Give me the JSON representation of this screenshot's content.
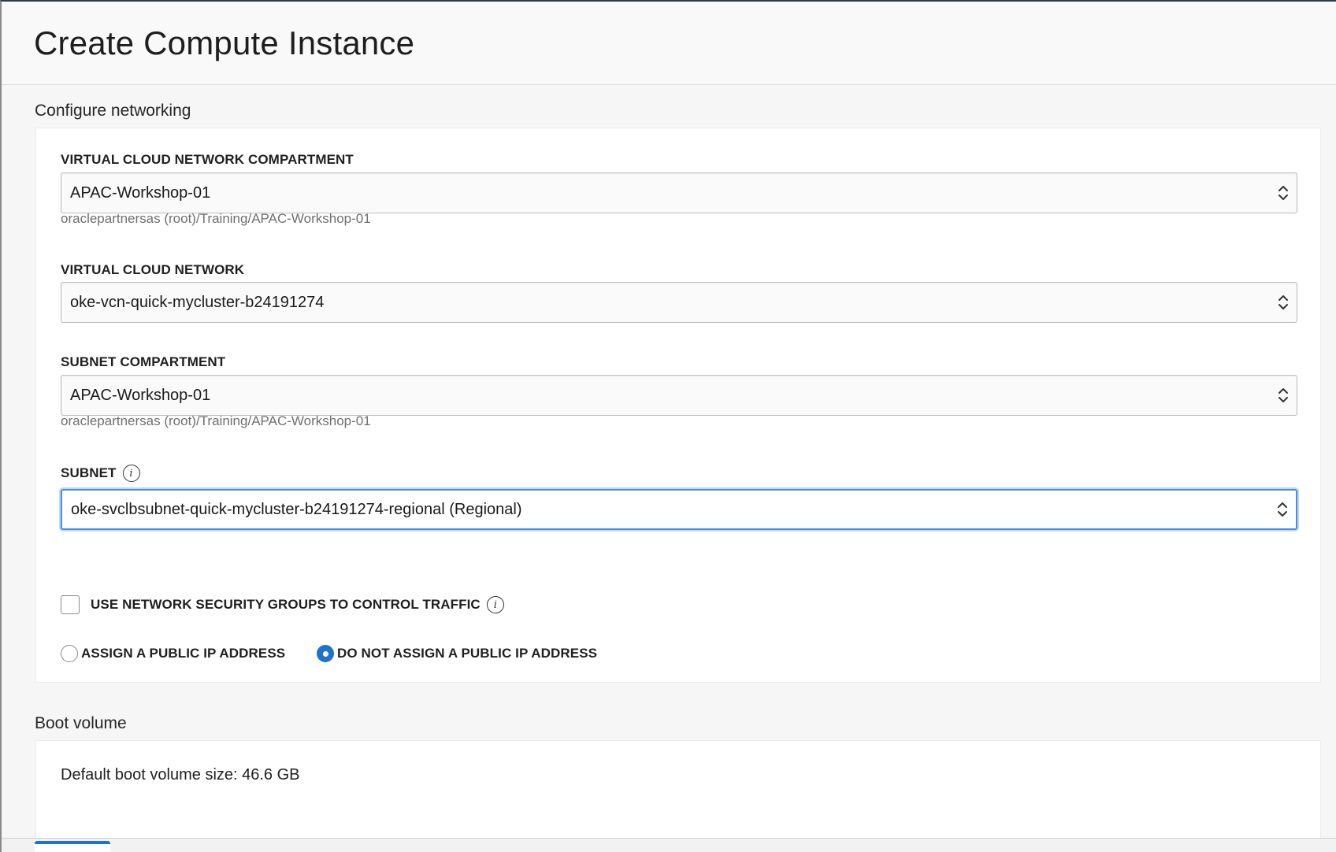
{
  "page": {
    "title": "Create Compute Instance"
  },
  "networking": {
    "section_title": "Configure networking",
    "vcn_compartment": {
      "label": "VIRTUAL CLOUD NETWORK COMPARTMENT",
      "value": "APAC-Workshop-01",
      "hint": "oraclepartnersas (root)/Training/APAC-Workshop-01"
    },
    "vcn": {
      "label": "VIRTUAL CLOUD NETWORK",
      "value": "oke-vcn-quick-mycluster-b24191274"
    },
    "subnet_compartment": {
      "label": "SUBNET COMPARTMENT",
      "value": "APAC-Workshop-01",
      "hint": "oraclepartnersas (root)/Training/APAC-Workshop-01"
    },
    "subnet": {
      "label": "SUBNET",
      "value": "oke-svclbsubnet-quick-mycluster-b24191274-regional (Regional)",
      "focused": true
    },
    "nsg_checkbox": {
      "label": "USE NETWORK SECURITY GROUPS TO CONTROL TRAFFIC",
      "checked": false
    },
    "public_ip": {
      "options": [
        {
          "label": "ASSIGN A PUBLIC IP ADDRESS",
          "selected": false
        },
        {
          "label": "DO NOT ASSIGN A PUBLIC IP ADDRESS",
          "selected": true
        }
      ]
    }
  },
  "boot_volume": {
    "section_title": "Boot volume",
    "default_size_text": "Default boot volume size: 46.6 GB"
  },
  "colors": {
    "accent": "#1f73c9",
    "focus_ring": "#4a8fd9",
    "header_border": "#2f3c47"
  },
  "icons": {
    "select_chevron": "chevron-up-down-icon",
    "info": "info-icon"
  }
}
